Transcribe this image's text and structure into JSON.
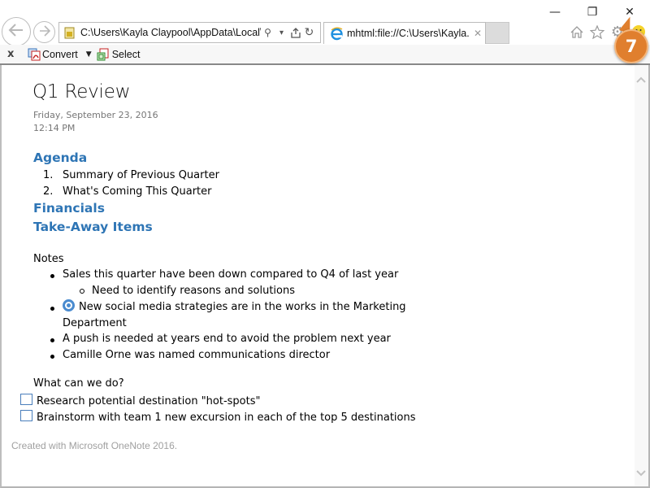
{
  "window": {
    "minimize_icon": "minimize-icon",
    "restore_icon": "restore-icon",
    "close_icon": "close-icon",
    "minimize_glyph": "—",
    "restore_glyph": "❐",
    "close_glyph": "✕"
  },
  "nav": {
    "back_glyph": "⇦",
    "forward_glyph": "⇨"
  },
  "address_bar": {
    "value": "C:\\Users\\Kayla Claypool\\AppData\\Local\\M",
    "search_glyph": "⚲",
    "dropdown_glyph": "▾",
    "pin_glyph": "⇪",
    "refresh_glyph": "↻"
  },
  "tab": {
    "title": "mhtml:file://C:\\Users\\Kayla...",
    "close_glyph": "✕"
  },
  "toolbar_icons": {
    "home_glyph": "⌂",
    "favorites_glyph": "☆",
    "tools_glyph": "⚙",
    "feedback_glyph": "☻"
  },
  "command_bar": {
    "close_glyph": "x",
    "convert_label": "Convert",
    "convert_dropdown_glyph": "▼",
    "select_label": "Select"
  },
  "scrollbar": {
    "up_glyph": "︿",
    "down_glyph": "﹀"
  },
  "document": {
    "title": "Q1 Review",
    "date": "Friday, September 23, 2016",
    "time": "12:14 PM",
    "headings": {
      "agenda": "Agenda",
      "financials": "Financials",
      "takeaway": "Take-Away Items"
    },
    "agenda_items": [
      {
        "num": "1.",
        "text": "Summary of Previous Quarter"
      },
      {
        "num": "2.",
        "text": "What's Coming This Quarter"
      }
    ],
    "notes_label": "Notes",
    "notes": [
      {
        "text": "Sales this quarter have been down compared to Q4 of last year"
      },
      {
        "text": "Need to identify reasons and solutions",
        "level": 2
      },
      {
        "text": "New social media strategies are in the works in the Marketing",
        "continuation": "Department",
        "tag": "radio-tag"
      },
      {
        "text": "A push is needed at years end to avoid the problem next year"
      },
      {
        "text": "Camille Orne was named communications director"
      }
    ],
    "question_label": "What can we do?",
    "todos": [
      {
        "text": "Research potential destination \"hot-spots\"",
        "checked": false
      },
      {
        "text": "Brainstorm with team 1 new excursion in each of the top 5 destinations",
        "checked": false
      }
    ],
    "footer": "Created with Microsoft OneNote 2016."
  },
  "callout": {
    "step_number": "7",
    "color": "#e07f2e"
  },
  "colors": {
    "heading_blue": "#2e75b5",
    "tag_blue": "#4a8bcf",
    "checkbox_border": "#4a7ebb",
    "meta_gray": "#767676",
    "footer_gray": "#a0a0a0"
  }
}
